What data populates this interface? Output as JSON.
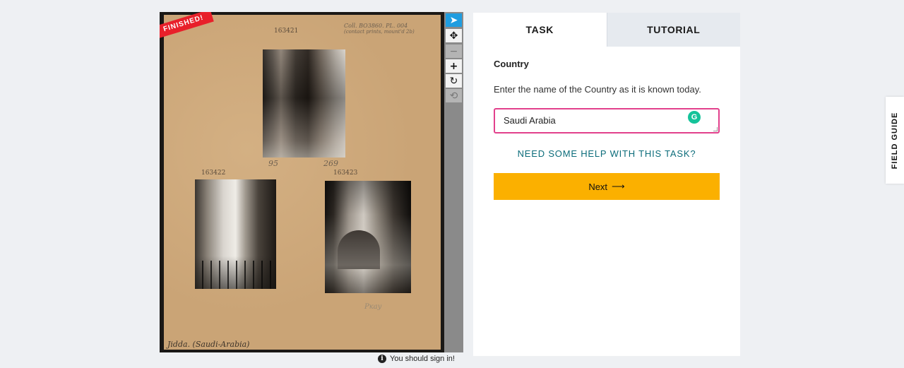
{
  "viewer": {
    "badge": "FINISHED!",
    "catalog_number_top": "163421",
    "catalog_number_left": "163422",
    "catalog_number_right": "163423",
    "collection_note": "Coll. BO3860. PL. 004",
    "collection_note_2": "(contact prints, mount'd 2b)",
    "pencil_mark_1": "95",
    "pencil_mark_2": "269",
    "caption": "Jidda. (Saudi-Arabia)",
    "scribble": "Ркау",
    "tools": [
      {
        "icon": "pointer-icon",
        "glyph": "➤"
      },
      {
        "icon": "move-icon",
        "glyph": "✥"
      },
      {
        "icon": "zoom-out-icon",
        "glyph": "−"
      },
      {
        "icon": "zoom-in-icon",
        "glyph": "+"
      },
      {
        "icon": "rotate-icon",
        "glyph": "↻"
      },
      {
        "icon": "reset-icon",
        "glyph": "⟲"
      }
    ],
    "signin_notice": "You should sign in!"
  },
  "panel": {
    "tabs": [
      {
        "label": "TASK",
        "active": true
      },
      {
        "label": "TUTORIAL",
        "active": false
      }
    ],
    "task_label": "Country",
    "instruction": "Enter the name of the Country as it is known today.",
    "answer_value": "Saudi Arabia",
    "help_link": "NEED SOME HELP WITH THIS TASK?",
    "next_button": "Next",
    "next_arrow": "⟶"
  },
  "field_guide": "FIELD GUIDE",
  "colors": {
    "accent_yellow": "#fbb000",
    "help_teal": "#0b6c7a",
    "input_border": "#e2408c",
    "finished_red": "#e8202a",
    "tool_active": "#1f9de0"
  }
}
